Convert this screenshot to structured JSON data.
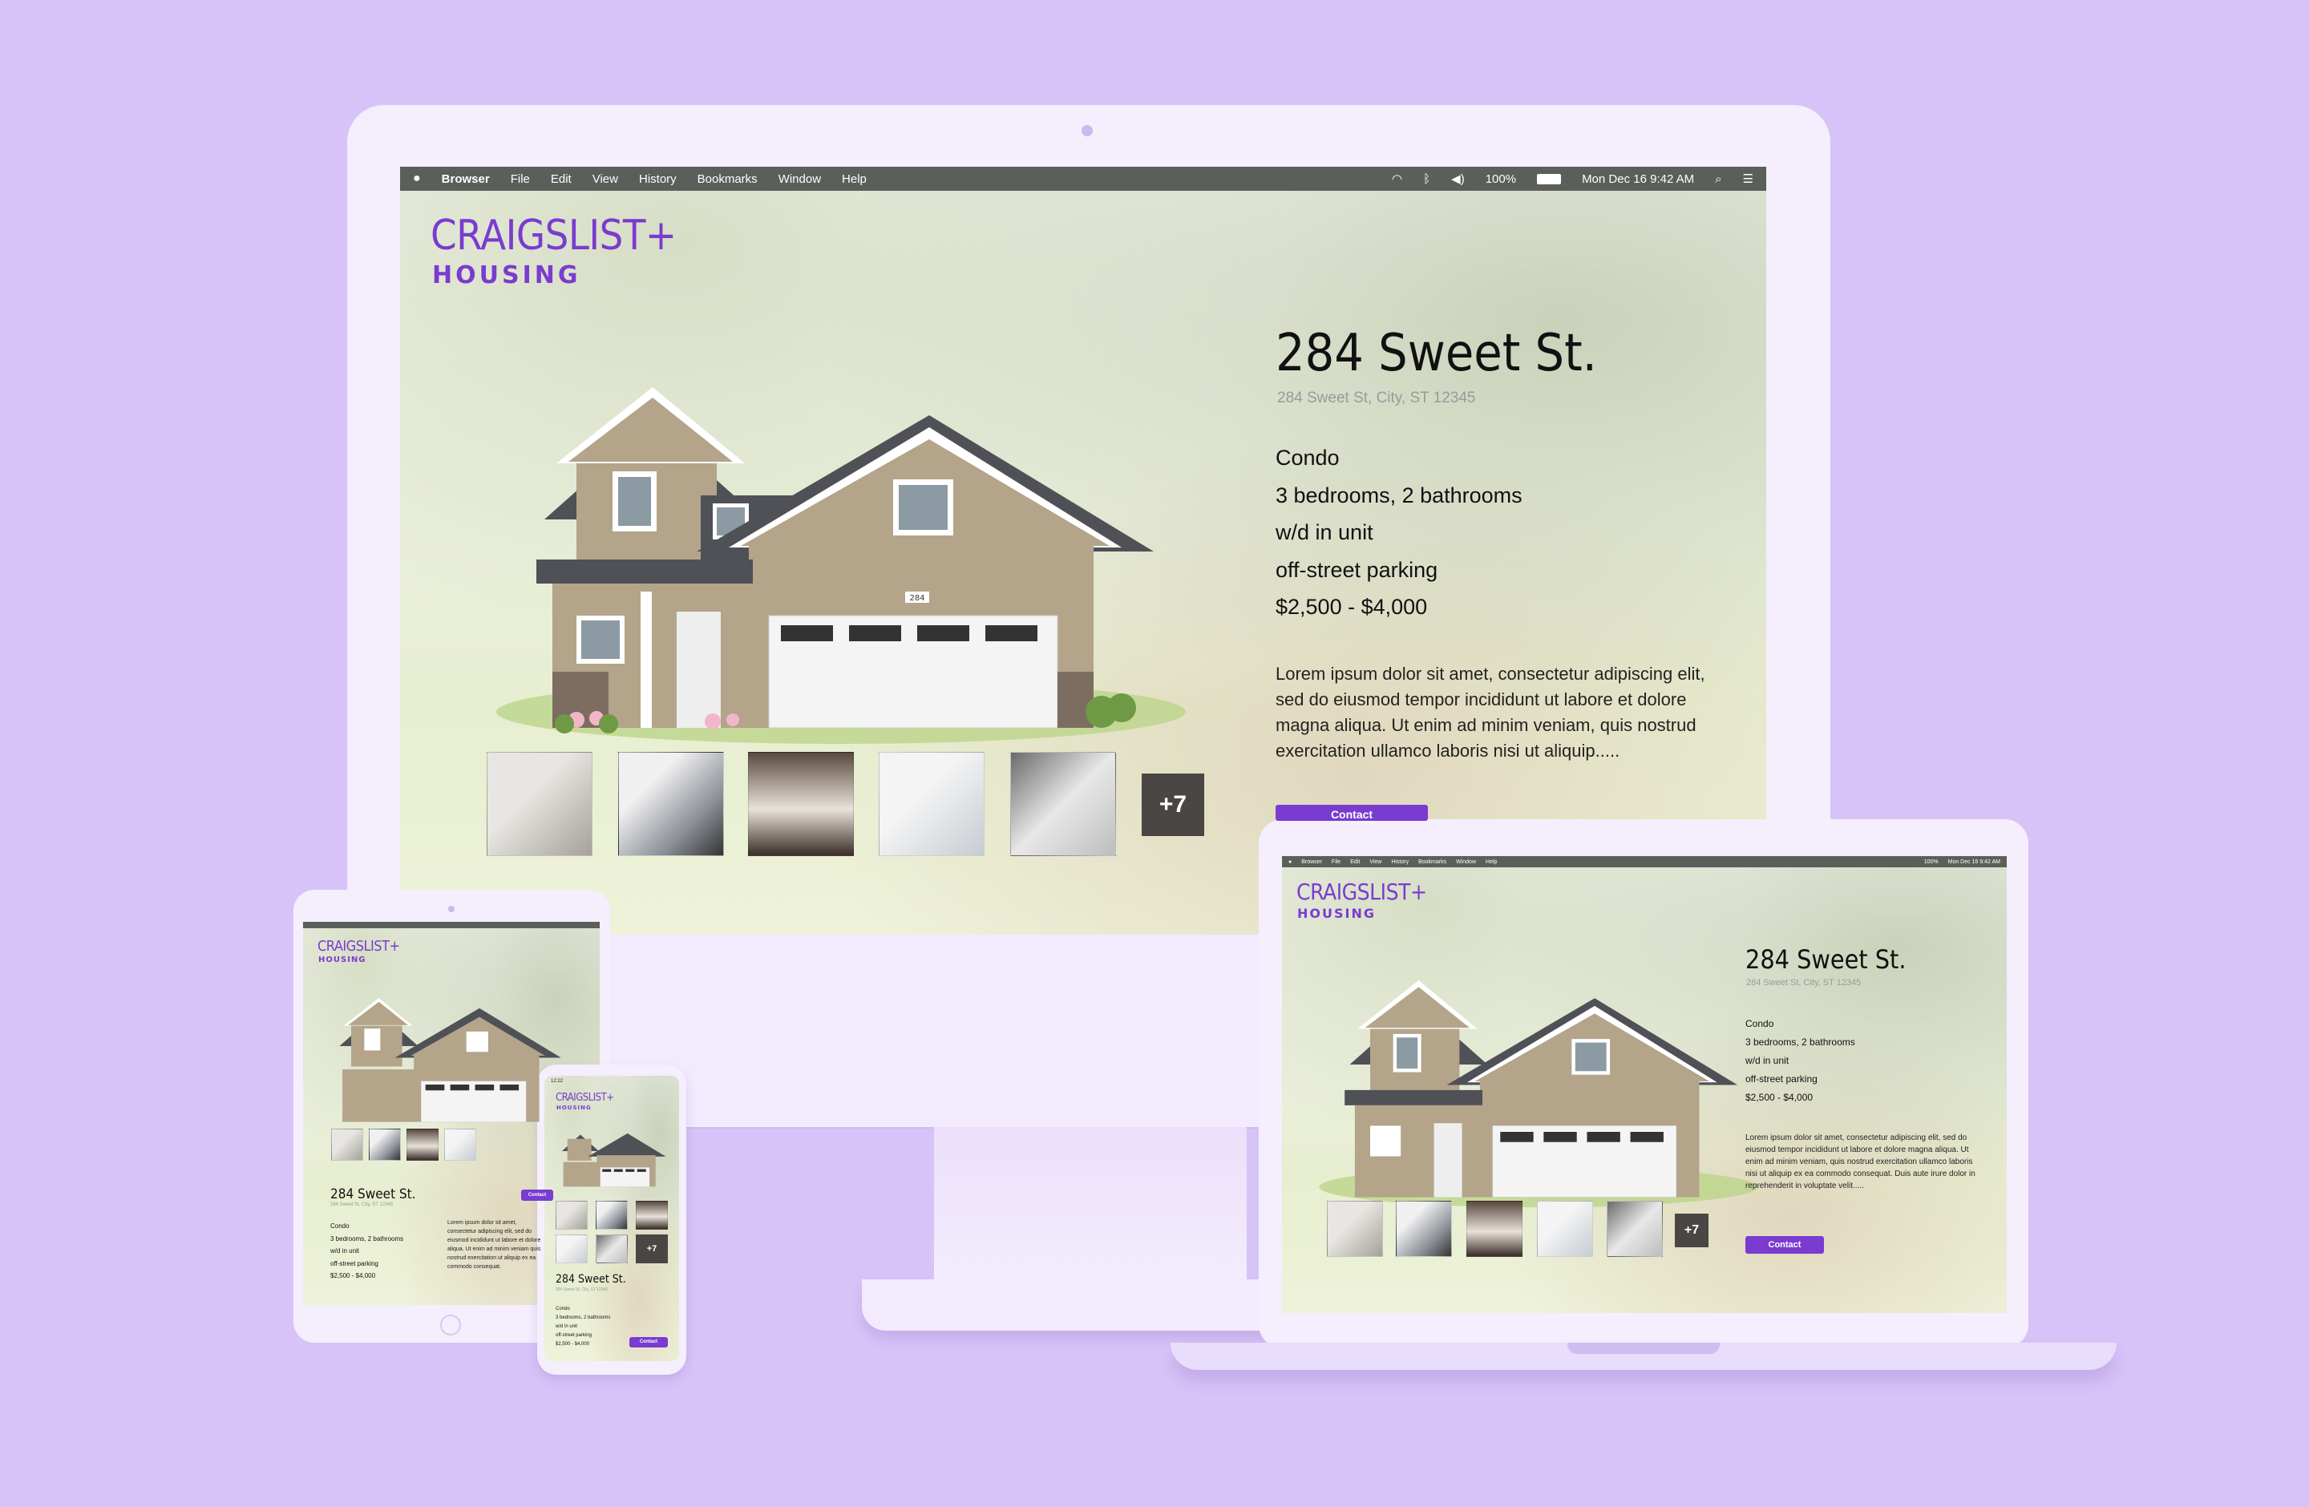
{
  "menubar": {
    "app": "Browser",
    "items": [
      "File",
      "Edit",
      "View",
      "History",
      "Bookmarks",
      "Window",
      "Help"
    ],
    "battery": "100%",
    "datetime": "Mon Dec 16  9:42 AM"
  },
  "logo": {
    "main": "CRAIGSLIST+",
    "sub": "HOUSING"
  },
  "listing": {
    "title": "284 Sweet St.",
    "address": "284 Sweet St, City, ST 12345",
    "features": [
      "Condo",
      "3 bedrooms, 2 bathrooms",
      "w/d in unit",
      "off-street parking",
      "$2,500 - $4,000"
    ],
    "description": "Lorem ipsum dolor sit amet, consectetur adipiscing elit, sed do eiusmod tempor incididunt ut labore et dolore magna aliqua. Ut enim ad minim veniam, quis nostrud exercitation ullamco laboris nisi ut aliquip.....",
    "description_long": "Lorem ipsum dolor sit amet, consectetur adipiscing elit, sed do eiusmod tempor incididunt ut labore et dolore magna aliqua. Ut enim ad minim veniam, quis nostrud exercitation ullamco laboris nisi ut aliquip ex ea commodo consequat. Duis aute irure dolor in reprehenderit in voluptate velit.....",
    "description_short": "Lorem ipsum dolor sit amet, consectetur adipiscing elit, sed do eiusmod incididunt ut labore et dolore aliqua. Ut enim ad minim veniam quis nostrud exercitation ut aliquip ex ea commodo consequat.",
    "house_number": "284",
    "more_photos": "+7",
    "contact_label": "Contact"
  },
  "phone_status": {
    "time": "12:22"
  },
  "colors": {
    "brand": "#7a3bd0",
    "background": "#d7c3f7",
    "device": "#f4eefd"
  }
}
